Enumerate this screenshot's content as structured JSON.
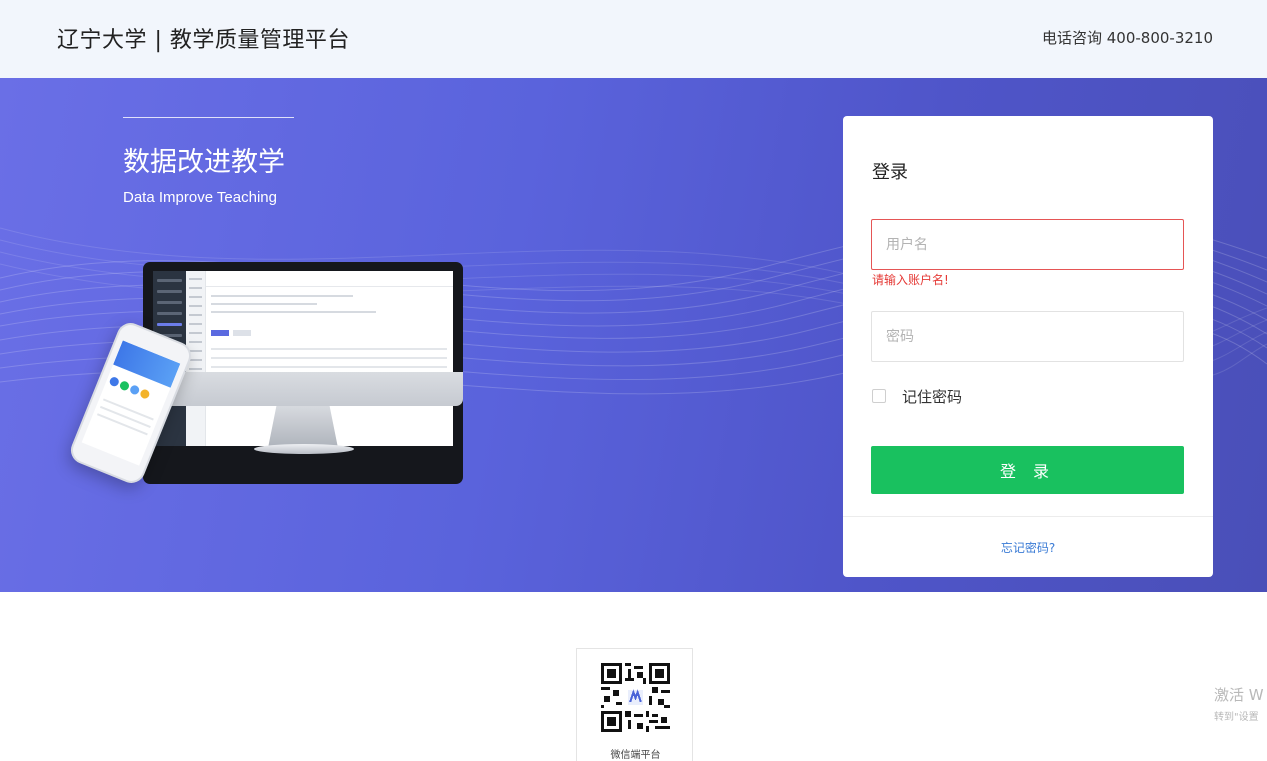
{
  "header": {
    "site_title": "辽宁大学 | 教学质量管理平台",
    "hotline": "电话咨询 400-800-3210"
  },
  "hero": {
    "title": "数据改进教学",
    "subtitle": "Data Improve Teaching"
  },
  "login": {
    "title": "登录",
    "username_placeholder": "用户名",
    "username_value": "",
    "username_error": "请输入账户名!",
    "password_placeholder": "密码",
    "password_value": "",
    "remember_label": "记住密码",
    "remember_checked": false,
    "submit_label": "登 录",
    "forgot_label": "忘记密码?"
  },
  "footer": {
    "qr_label": "微信端平台"
  },
  "watermark": {
    "title": "激活 W",
    "subtitle": "转到\"设置"
  },
  "colors": {
    "header_bg": "#f2f6fc",
    "hero_gradient_start": "#6a6fe6",
    "hero_gradient_end": "#4a4fb8",
    "login_button": "#19c15f",
    "error": "#e53935",
    "link": "#3a7bd5"
  }
}
